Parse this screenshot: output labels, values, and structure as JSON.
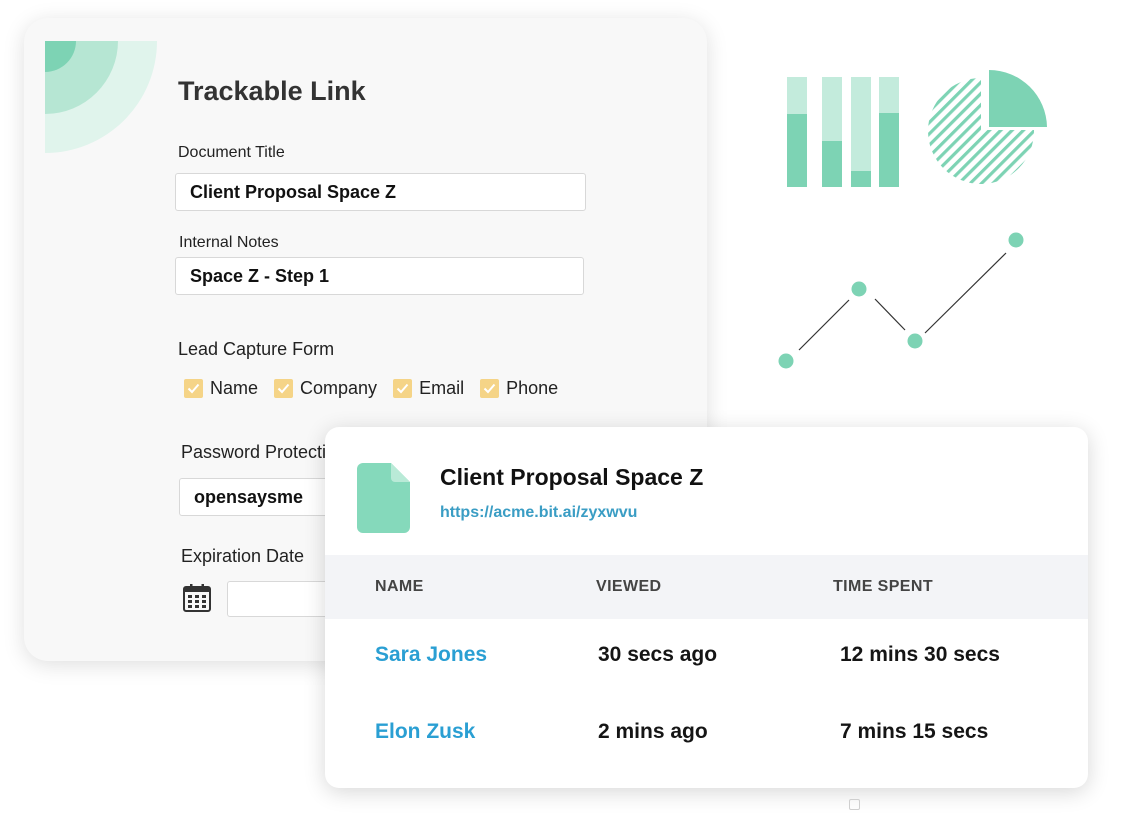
{
  "form": {
    "title": "Trackable Link",
    "document_title": {
      "label": "Document Title",
      "value": "Client Proposal Space Z"
    },
    "internal_notes": {
      "label": "Internal Notes",
      "value": "Space Z - Step 1"
    },
    "lead_capture": {
      "label": "Lead Capture Form",
      "options": [
        {
          "label": "Name",
          "checked": true
        },
        {
          "label": "Company",
          "checked": true
        },
        {
          "label": "Email",
          "checked": true
        },
        {
          "label": "Phone",
          "checked": true
        }
      ]
    },
    "password": {
      "label": "Password Protection",
      "value": "opensaysme"
    },
    "expiration": {
      "label": "Expiration Date",
      "value": ""
    }
  },
  "tracking": {
    "doc_title": "Client Proposal Space Z",
    "doc_link": "https://acme.bit.ai/zyxwvu",
    "columns": [
      "NAME",
      "VIEWED",
      "TIME SPENT"
    ],
    "rows": [
      {
        "name": "Sara Jones",
        "viewed": "30 secs ago",
        "time_spent": "12 mins 30 secs"
      },
      {
        "name": "Elon Zusk",
        "viewed": "2 mins ago",
        "time_spent": "7 mins 15 secs"
      }
    ]
  },
  "colors": {
    "accent_green": "#7dd3b4",
    "light_green": "#c3ebdc",
    "checkbox_yellow": "#f5d487",
    "link_blue": "#2a9fd3"
  },
  "icons": [
    "checkmark-icon",
    "calendar-icon",
    "document-icon"
  ]
}
